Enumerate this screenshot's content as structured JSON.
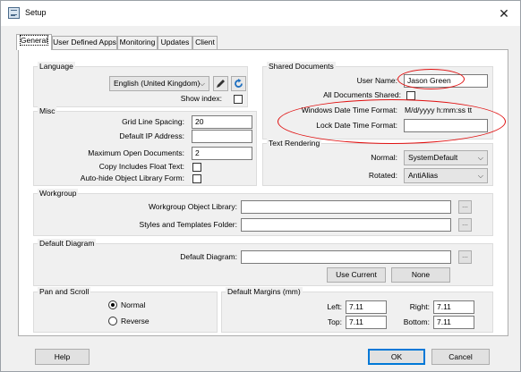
{
  "window": {
    "title": "Setup"
  },
  "tabs": [
    {
      "label": "General"
    },
    {
      "label": "User Defined Apps"
    },
    {
      "label": "Monitoring"
    },
    {
      "label": "Updates"
    },
    {
      "label": "Client"
    }
  ],
  "language": {
    "title": "Language",
    "selected": "English (United Kingdom)",
    "show_index_label": "Show index:"
  },
  "misc": {
    "title": "Misc",
    "grid_line_spacing_label": "Grid Line Spacing:",
    "grid_line_spacing": "20",
    "default_ip_label": "Default IP Address:",
    "default_ip": "",
    "max_docs_label": "Maximum Open Documents:",
    "max_docs": "2",
    "copy_float_label": "Copy Includes Float Text:",
    "autohide_label": "Auto-hide Object Library Form:"
  },
  "shared_documents": {
    "title": "Shared Documents",
    "user_name_label": "User Name:",
    "user_name": "Jason Green",
    "all_shared_label": "All Documents Shared:",
    "windows_dt_label": "Windows Date Time Format:",
    "windows_dt": "M/d/yyyy h:mm:ss tt",
    "lock_dt_label": "Lock Date Time Format:",
    "lock_dt": ""
  },
  "text_rendering": {
    "title": "Text Rendering",
    "normal_label": "Normal:",
    "normal": "SystemDefault",
    "rotated_label": "Rotated:",
    "rotated": "AntiAlias"
  },
  "workgroup": {
    "title": "Workgroup",
    "object_library_label": "Workgroup Object Library:",
    "object_library": "",
    "styles_folder_label": "Styles and Templates Folder:",
    "styles_folder": "",
    "browse": "..."
  },
  "default_diagram": {
    "title": "Default Diagram",
    "diagram_label": "Default Diagram:",
    "diagram": "",
    "browse": "...",
    "use_current": "Use Current",
    "none": "None"
  },
  "pan_scroll": {
    "title": "Pan and Scroll",
    "normal": "Normal",
    "reverse": "Reverse",
    "selected": "Normal"
  },
  "margins": {
    "title": "Default Margins (mm)",
    "left_label": "Left:",
    "left": "7.11",
    "right_label": "Right:",
    "right": "7.11",
    "top_label": "Top:",
    "top": "7.11",
    "bottom_label": "Bottom:",
    "bottom": "7.11"
  },
  "footer": {
    "help": "Help",
    "ok": "OK",
    "cancel": "Cancel"
  },
  "colors": {
    "annotation": "#e01010",
    "focus": "#0078d7",
    "refresh_icon": "#1e6fc0"
  }
}
